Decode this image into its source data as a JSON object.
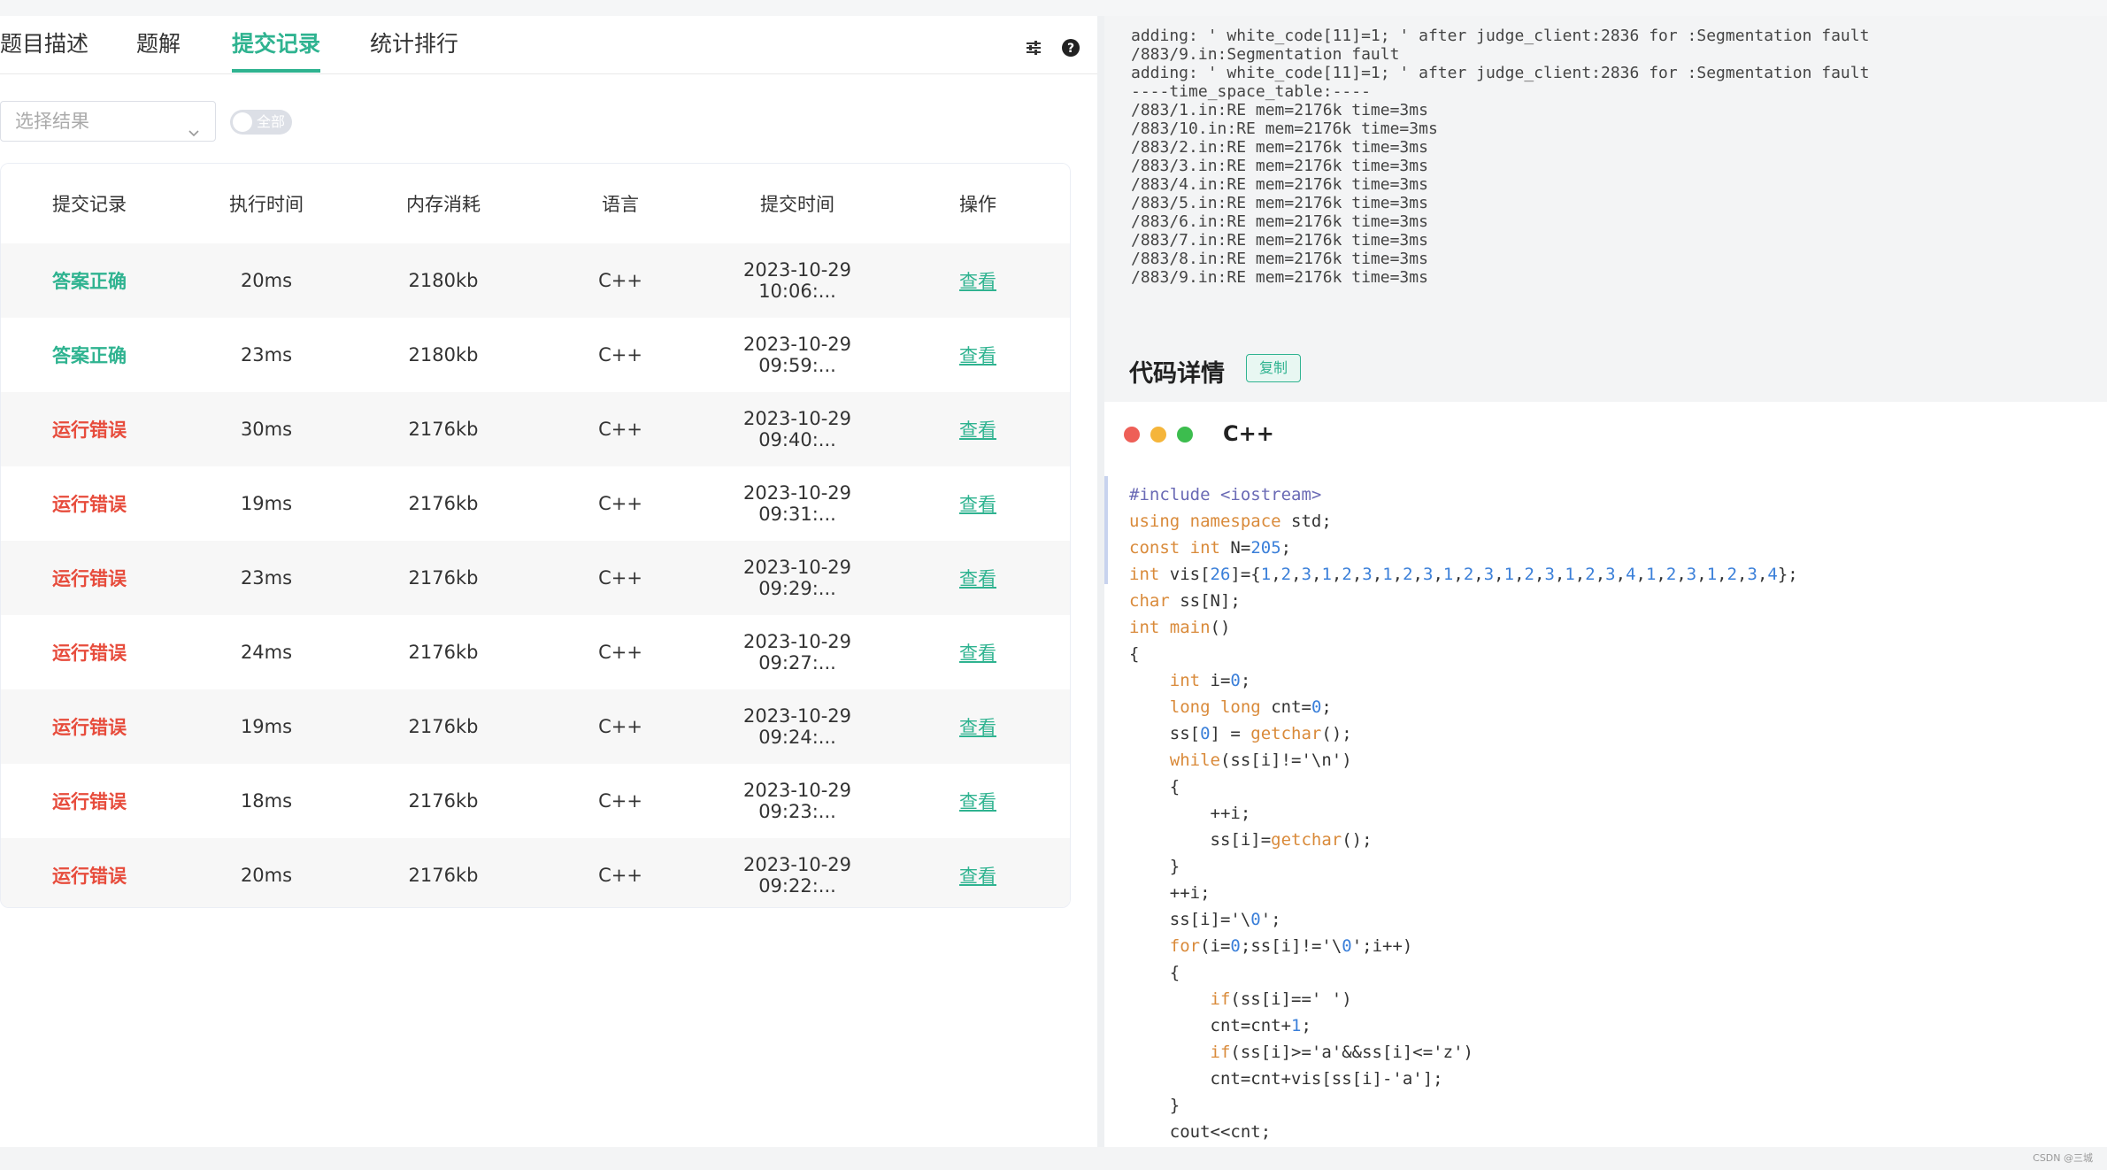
{
  "tabs": [
    {
      "label": "题目描述",
      "active": false
    },
    {
      "label": "题解",
      "active": false
    },
    {
      "label": "提交记录",
      "active": true
    },
    {
      "label": "统计排行",
      "active": false
    }
  ],
  "icons": {
    "settings": "sliders-icon",
    "help": "question-circle-icon"
  },
  "filter": {
    "placeholder": "选择结果",
    "toggle_label": "全部"
  },
  "table": {
    "headers": [
      "提交记录",
      "执行时间",
      "内存消耗",
      "语言",
      "提交时间",
      "操作"
    ],
    "rows": [
      {
        "status": "答案正确",
        "status_type": "ok",
        "time": "20ms",
        "memory": "2180kb",
        "lang": "C++",
        "submitted": "2023-10-29  10:06:...",
        "action": "查看"
      },
      {
        "status": "答案正确",
        "status_type": "ok",
        "time": "23ms",
        "memory": "2180kb",
        "lang": "C++",
        "submitted": "2023-10-29  09:59:...",
        "action": "查看"
      },
      {
        "status": "运行错误",
        "status_type": "re",
        "time": "30ms",
        "memory": "2176kb",
        "lang": "C++",
        "submitted": "2023-10-29  09:40:...",
        "action": "查看"
      },
      {
        "status": "运行错误",
        "status_type": "re",
        "time": "19ms",
        "memory": "2176kb",
        "lang": "C++",
        "submitted": "2023-10-29  09:31:...",
        "action": "查看"
      },
      {
        "status": "运行错误",
        "status_type": "re",
        "time": "23ms",
        "memory": "2176kb",
        "lang": "C++",
        "submitted": "2023-10-29  09:29:...",
        "action": "查看"
      },
      {
        "status": "运行错误",
        "status_type": "re",
        "time": "24ms",
        "memory": "2176kb",
        "lang": "C++",
        "submitted": "2023-10-29  09:27:...",
        "action": "查看"
      },
      {
        "status": "运行错误",
        "status_type": "re",
        "time": "19ms",
        "memory": "2176kb",
        "lang": "C++",
        "submitted": "2023-10-29  09:24:...",
        "action": "查看"
      },
      {
        "status": "运行错误",
        "status_type": "re",
        "time": "18ms",
        "memory": "2176kb",
        "lang": "C++",
        "submitted": "2023-10-29  09:23:...",
        "action": "查看"
      },
      {
        "status": "运行错误",
        "status_type": "re",
        "time": "20ms",
        "memory": "2176kb",
        "lang": "C++",
        "submitted": "2023-10-29  09:22:...",
        "action": "查看"
      }
    ]
  },
  "log_lines": [
    "adding: ' white_code[11]=1; ' after judge_client:2836 for :Segmentation fault",
    "/883/9.in:Segmentation fault",
    "adding: ' white_code[11]=1; ' after judge_client:2836 for :Segmentation fault",
    "----time_space_table:----",
    "/883/1.in:RE mem=2176k time=3ms",
    "/883/10.in:RE mem=2176k time=3ms",
    "/883/2.in:RE mem=2176k time=3ms",
    "/883/3.in:RE mem=2176k time=3ms",
    "/883/4.in:RE mem=2176k time=3ms",
    "/883/5.in:RE mem=2176k time=3ms",
    "/883/6.in:RE mem=2176k time=3ms",
    "/883/7.in:RE mem=2176k time=3ms",
    "/883/8.in:RE mem=2176k time=3ms",
    "/883/9.in:RE mem=2176k time=3ms"
  ],
  "code_panel": {
    "title": "代码详情",
    "copy_label": "复制",
    "language": "C++",
    "window_dot_colors": [
      "#ee5f57",
      "#f5b53a",
      "#3cbd4e"
    ]
  },
  "code_lines": [
    "#include <iostream>",
    "using namespace std;",
    "const int N=205;",
    "int vis[26]={1,2,3,1,2,3,1,2,3,1,2,3,1,2,3,1,2,3,4,1,2,3,1,2,3,4};",
    "char ss[N];",
    "int main()",
    "{",
    "    int i=0;",
    "    long long cnt=0;",
    "    ss[0] = getchar();",
    "    while(ss[i]!='\\n')",
    "    {",
    "        ++i;",
    "        ss[i]=getchar();",
    "    }",
    "    ++i;",
    "    ss[i]='\\0';",
    "    for(i=0;ss[i]!='\\0';i++)",
    "    {",
    "        if(ss[i]==' ')",
    "        cnt=cnt+1;",
    "        if(ss[i]>='a'&&ss[i]<='z')",
    "        cnt=cnt+vis[ss[i]-'a'];",
    "    }",
    "    cout<<cnt;"
  ],
  "colors": {
    "accent": "#2fb390",
    "error": "#e74c3c",
    "keyword": "#d98a3a",
    "number": "#3a7fd9"
  },
  "watermark": "CSDN @三城"
}
